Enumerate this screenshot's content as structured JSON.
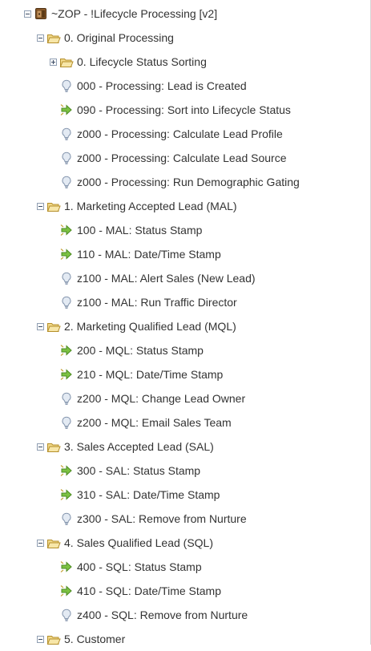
{
  "tree": {
    "root": {
      "label": "~ZOP - !Lifecycle Processing [v2]",
      "icon": "program-box-icon"
    },
    "folders": [
      {
        "label": "0. Original Processing",
        "icon": "folder-open-icon",
        "subfolders": [
          {
            "label": "0. Lifecycle Status Sorting",
            "icon": "folder-icon",
            "collapsed": true
          }
        ],
        "items": [
          {
            "label": "000 - Processing: Lead is Created",
            "icon": "lightbulb-icon"
          },
          {
            "label": "090 - Processing: Sort into Lifecycle Status",
            "icon": "trigger-arrow-icon"
          },
          {
            "label": "z000 - Processing: Calculate Lead Profile",
            "icon": "lightbulb-icon"
          },
          {
            "label": "z000 - Processing: Calculate Lead Source",
            "icon": "lightbulb-icon"
          },
          {
            "label": "z000 - Processing: Run Demographic Gating",
            "icon": "lightbulb-icon"
          }
        ]
      },
      {
        "label": "1. Marketing Accepted Lead (MAL)",
        "icon": "folder-open-icon",
        "items": [
          {
            "label": "100 - MAL: Status Stamp",
            "icon": "trigger-arrow-icon"
          },
          {
            "label": "110 - MAL: Date/Time Stamp",
            "icon": "trigger-arrow-icon"
          },
          {
            "label": "z100 - MAL: Alert Sales (New Lead)",
            "icon": "lightbulb-icon"
          },
          {
            "label": "z100 - MAL: Run Traffic Director",
            "icon": "lightbulb-icon"
          }
        ]
      },
      {
        "label": "2. Marketing Qualified Lead (MQL)",
        "icon": "folder-open-icon",
        "items": [
          {
            "label": "200 - MQL: Status Stamp",
            "icon": "trigger-arrow-icon"
          },
          {
            "label": "210 - MQL: Date/Time Stamp",
            "icon": "trigger-arrow-icon"
          },
          {
            "label": "z200 - MQL: Change Lead Owner",
            "icon": "lightbulb-icon"
          },
          {
            "label": "z200 - MQL: Email Sales Team",
            "icon": "lightbulb-icon"
          }
        ]
      },
      {
        "label": "3. Sales Accepted Lead (SAL)",
        "icon": "folder-open-icon",
        "items": [
          {
            "label": "300 - SAL: Status Stamp",
            "icon": "trigger-arrow-icon"
          },
          {
            "label": "310 - SAL: Date/Time Stamp",
            "icon": "trigger-arrow-icon"
          },
          {
            "label": "z300 - SAL: Remove from Nurture",
            "icon": "lightbulb-icon"
          }
        ]
      },
      {
        "label": "4. Sales Qualified Lead (SQL)",
        "icon": "folder-open-icon",
        "items": [
          {
            "label": "400 - SQL: Status Stamp",
            "icon": "trigger-arrow-icon"
          },
          {
            "label": "410 - SQL: Date/Time Stamp",
            "icon": "trigger-arrow-icon"
          },
          {
            "label": "z400 - SQL: Remove from Nurture",
            "icon": "lightbulb-icon"
          }
        ]
      },
      {
        "label": "5. Customer",
        "icon": "folder-open-icon",
        "items": []
      }
    ]
  },
  "colors": {
    "folder_fill": "#f1d98a",
    "folder_stroke": "#b58f2b",
    "trigger_green": "#7cc242",
    "bulb_fill": "#e3eaf3",
    "bulb_stroke": "#8495ad",
    "toggle_border": "#8f9eb2",
    "text": "#333333"
  }
}
